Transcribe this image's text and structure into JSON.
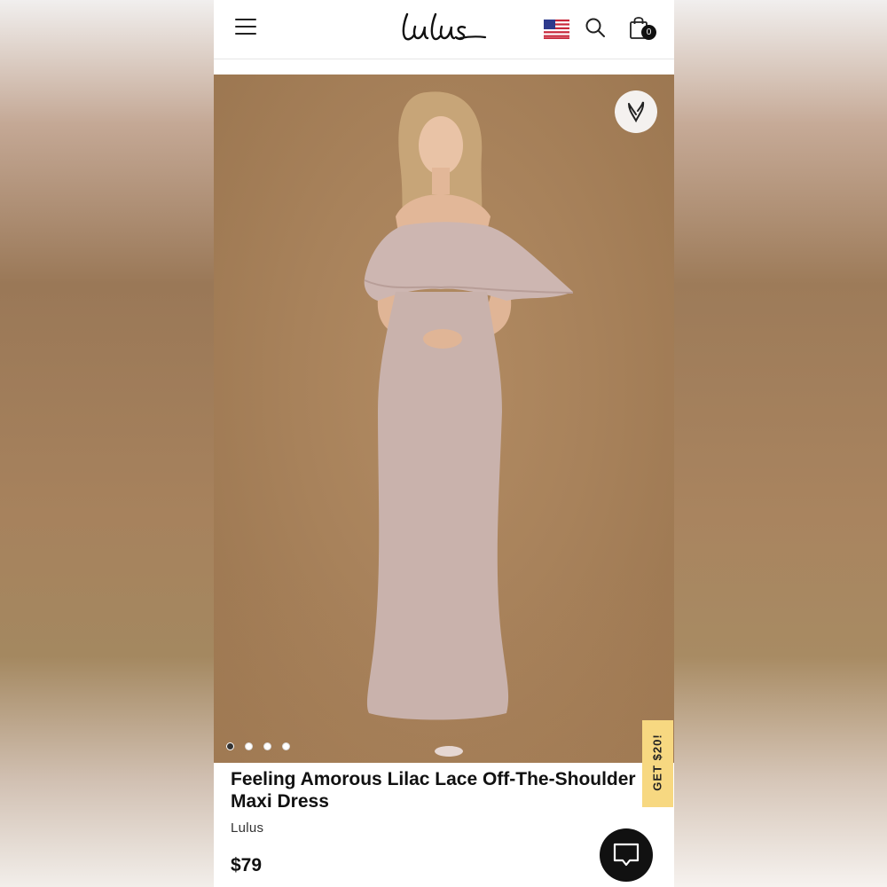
{
  "header": {
    "logo_text": "Lulus",
    "cart_count": "0",
    "icons": [
      "menu-icon",
      "us-flag-icon",
      "search-icon",
      "shopping-bag-icon"
    ]
  },
  "gallery": {
    "image_description": "Model wearing lilac lace off-the-shoulder maxi dress",
    "slide_count": 4,
    "active_slide": 1,
    "wishlist_icon": "heart-icon"
  },
  "promo": {
    "label": "GET $20!"
  },
  "product": {
    "title": "Feeling Amorous Lilac Lace Off-The-Shoulder Maxi Dress",
    "brand": "Lulus",
    "price": "$79"
  },
  "chat": {
    "icon": "chat-icon"
  },
  "colors": {
    "promo_bg": "#f7d881",
    "photo_bg": "#a8825b",
    "dress": "#c9b2ac"
  }
}
